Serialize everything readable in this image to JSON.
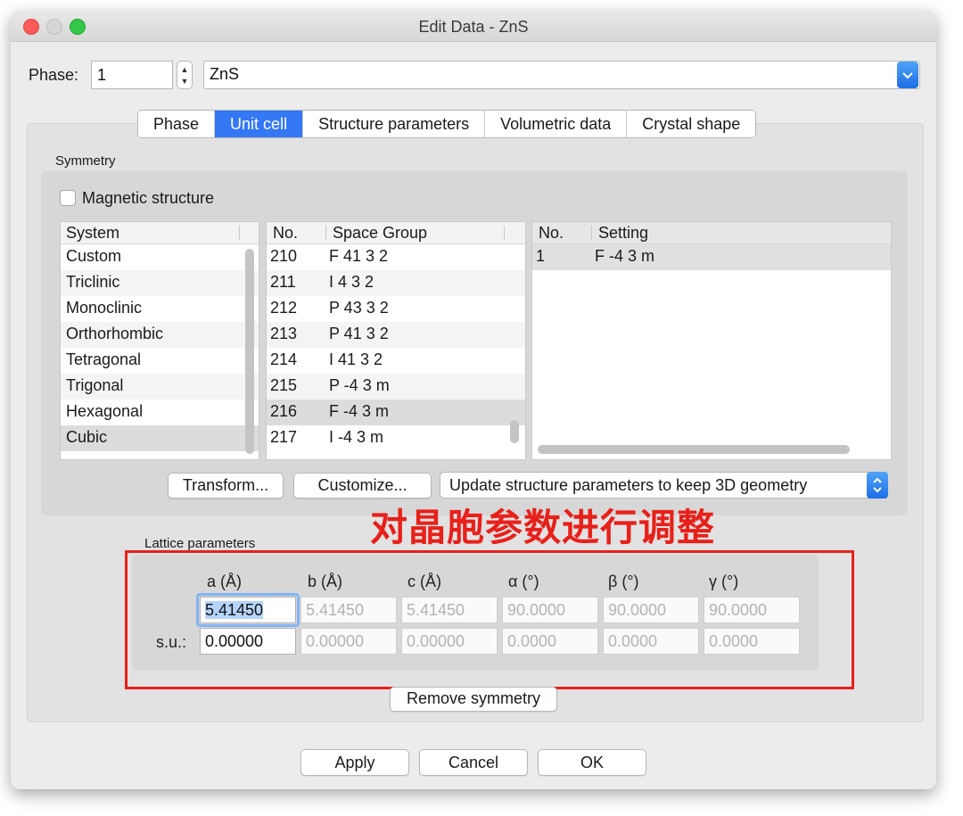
{
  "window": {
    "title": "Edit Data - ZnS"
  },
  "phase": {
    "label": "Phase:",
    "number": "1",
    "name": "ZnS"
  },
  "tabs": [
    "Phase",
    "Unit cell",
    "Structure parameters",
    "Volumetric data",
    "Crystal shape"
  ],
  "symmetry": {
    "group_label": "Symmetry",
    "magnetic_label": "Magnetic structure",
    "system": {
      "header": "System",
      "items": [
        "Custom",
        "Triclinic",
        "Monoclinic",
        "Orthorhombic",
        "Tetragonal",
        "Trigonal",
        "Hexagonal",
        "Cubic"
      ],
      "selected": "Cubic"
    },
    "space_group": {
      "header_no": "No.",
      "header_name": "Space Group",
      "rows": [
        {
          "no": "210",
          "name": "F 41 3 2"
        },
        {
          "no": "211",
          "name": "I 4 3 2"
        },
        {
          "no": "212",
          "name": "P 43 3 2"
        },
        {
          "no": "213",
          "name": "P 41 3 2"
        },
        {
          "no": "214",
          "name": "I 41 3 2"
        },
        {
          "no": "215",
          "name": "P -4 3 m"
        },
        {
          "no": "216",
          "name": "F -4 3 m"
        },
        {
          "no": "217",
          "name": "I -4 3 m"
        }
      ],
      "selected_no": "216"
    },
    "setting": {
      "header_no": "No.",
      "header_name": "Setting",
      "rows": [
        {
          "no": "1",
          "name": "F -4 3 m"
        }
      ]
    },
    "buttons": {
      "transform": "Transform...",
      "customize": "Customize..."
    },
    "update_option": "Update structure parameters to keep 3D geometry"
  },
  "annotation": "对晶胞参数进行调整",
  "lattice": {
    "group_label": "Lattice parameters",
    "headers": [
      "a (Å)",
      "b (Å)",
      "c (Å)",
      "α (°)",
      "β (°)",
      "γ (°)"
    ],
    "values": [
      "5.41450",
      "5.41450",
      "5.41450",
      "90.0000",
      "90.0000",
      "90.0000"
    ],
    "su_label": "s.u.:",
    "su": [
      "0.00000",
      "0.00000",
      "0.00000",
      "0.0000",
      "0.0000",
      "0.0000"
    ],
    "remove_symmetry": "Remove symmetry"
  },
  "dialog_buttons": {
    "apply": "Apply",
    "cancel": "Cancel",
    "ok": "OK"
  },
  "colors": {
    "accent": "#3478f6",
    "annotation_red": "#e8201a"
  }
}
